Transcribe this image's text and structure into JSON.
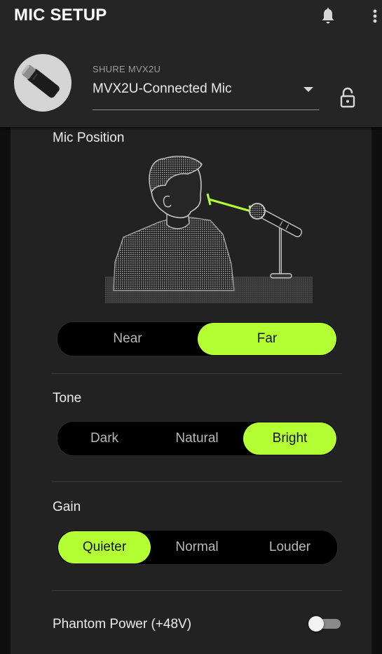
{
  "header": {
    "title": "MIC SETUP",
    "icons": [
      "bell-icon",
      "more-vertical-icon"
    ],
    "device_brand": "SHURE MVX2U",
    "device_selected": "MVX2U-Connected Mic",
    "lock_icon": "lock-open-icon"
  },
  "mic_position": {
    "label": "Mic Position",
    "options": [
      "Near",
      "Far"
    ],
    "selected": "Far"
  },
  "tone": {
    "label": "Tone",
    "options": [
      "Dark",
      "Natural",
      "Bright"
    ],
    "selected": "Bright"
  },
  "gain": {
    "label": "Gain",
    "options": [
      "Quieter",
      "Normal",
      "Louder"
    ],
    "selected": "Quieter"
  },
  "phantom_power": {
    "label": "Phantom Power (+48V)",
    "enabled": false
  },
  "colors": {
    "accent": "#b3ff33",
    "header_bg": "#252525",
    "panel_bg": "#222222",
    "segment_bg": "#000000"
  }
}
